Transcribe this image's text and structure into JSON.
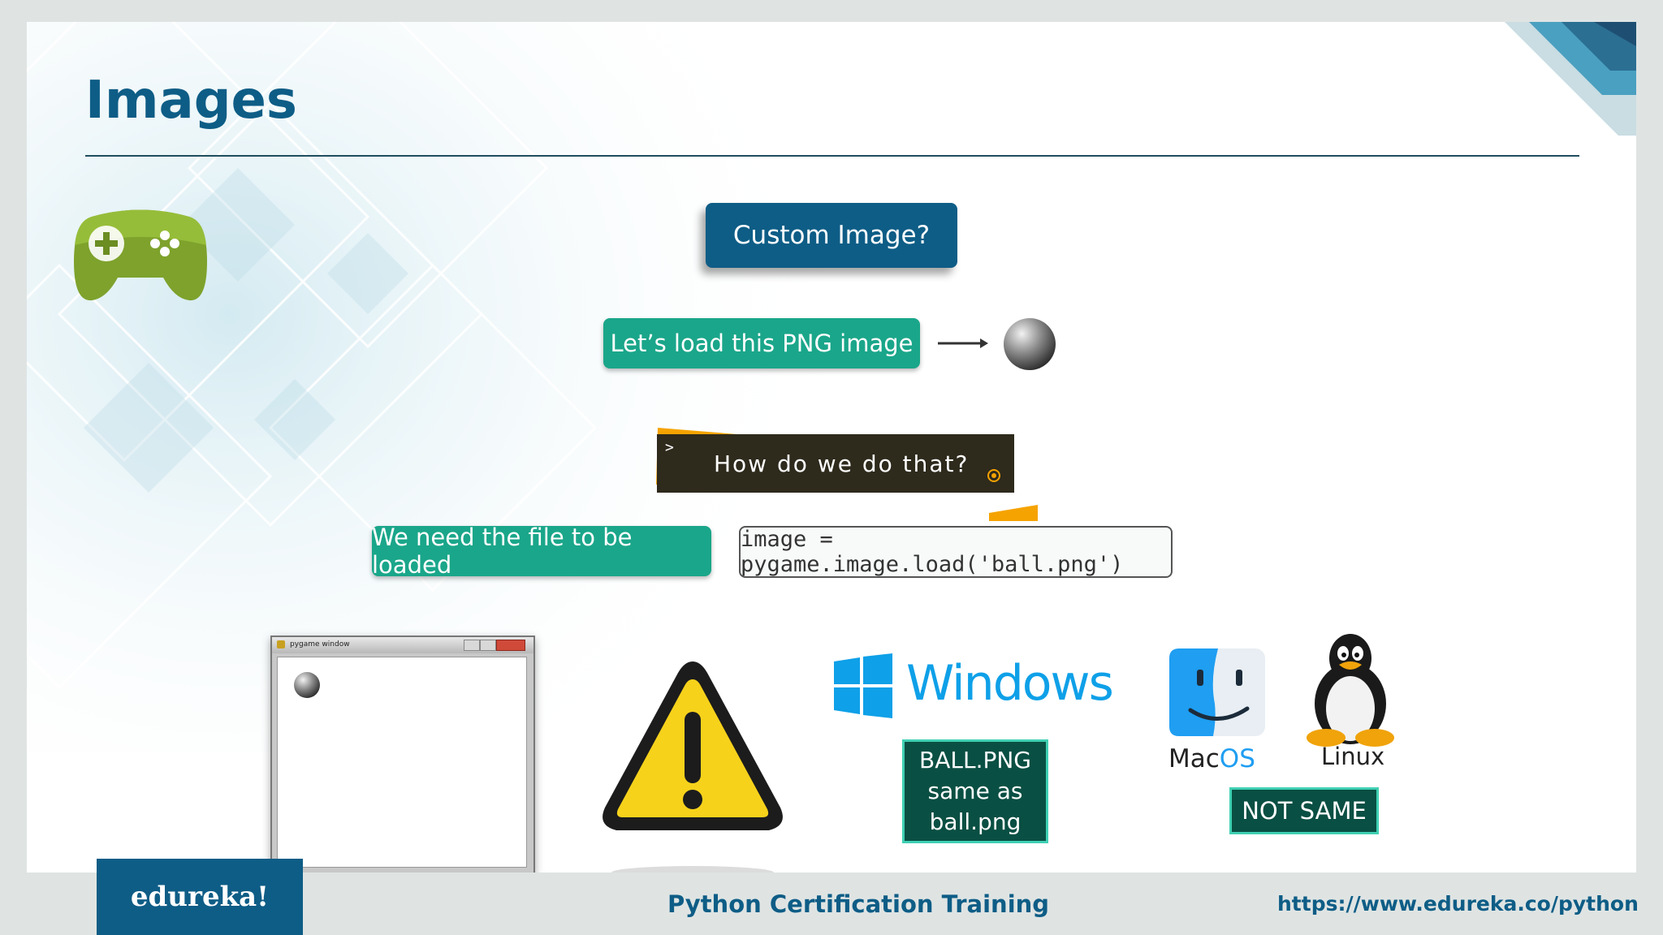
{
  "slide": {
    "title": "Images",
    "custom_image_label": "Custom Image?",
    "load_png_label": "Let’s load this PNG image",
    "question_prompt": ">",
    "question": "How do we do that?",
    "file_loaded_label": "We need the file to be loaded",
    "code": "image = pygame.image.load('ball.png')",
    "window_title": "pygame window",
    "windows_label": "Windows",
    "windows_note_lines": [
      "BALL.PNG",
      "same as",
      "ball.png"
    ],
    "macos_label_mac": "Mac",
    "macos_label_os": "OS",
    "linux_label": "Linux",
    "not_same_label": "NOT SAME"
  },
  "footer": {
    "brand": "edureka!",
    "course": "Python Certification Training",
    "url": "https://www.edureka.co/python"
  },
  "colors": {
    "title": "#0e5d86",
    "teal_box": "#1aa68a",
    "navy_box": "#0e5d86",
    "dark_teal_box": "#0a4f43",
    "orange_accent": "#f5a300"
  },
  "icons": [
    "gamepad-icon",
    "arrow-right-icon",
    "ball-icon",
    "warning-icon",
    "windows-logo-icon",
    "macos-finder-icon",
    "linux-tux-icon"
  ]
}
